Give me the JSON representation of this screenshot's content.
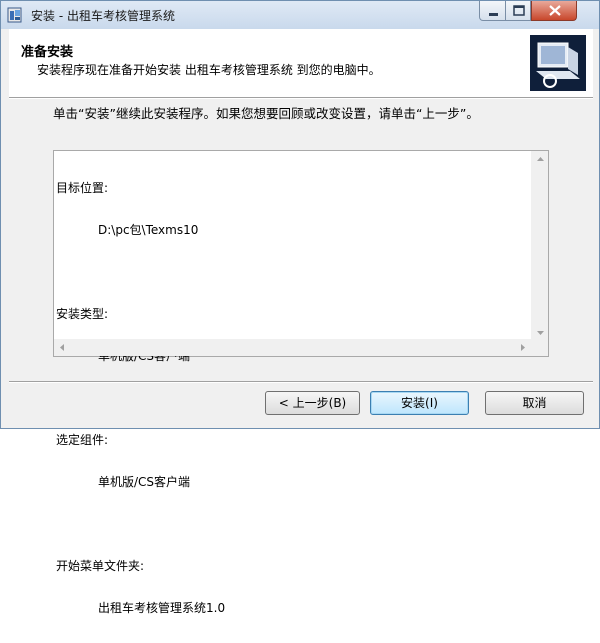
{
  "window": {
    "title": "安装 - 出租车考核管理系统"
  },
  "header": {
    "title": "准备安装",
    "description": "安装程序现在准备开始安装 出租车考核管理系统 到您的电脑中。"
  },
  "instruction": "单击“安装”继续此安装程序。如果您想要回顾或改变设置，请单击“上一步”。",
  "summary": {
    "items": [
      {
        "label": "目标位置:",
        "value": "D:\\pc包\\Texms10"
      },
      {
        "label": "安装类型:",
        "value": "单机版/CS客户端"
      },
      {
        "label": "选定组件:",
        "value": "单机版/CS客户端"
      },
      {
        "label": "开始菜单文件夹:",
        "value": "出租车考核管理系统1.0"
      }
    ]
  },
  "buttons": {
    "back": "< 上一步(B)",
    "install": "安装(I)",
    "cancel": "取消"
  },
  "icons": {
    "app": "setup-app-icon",
    "logo": "computer-install-icon"
  },
  "colors": {
    "accent": "#3c7fb1",
    "close": "#c8472b"
  }
}
